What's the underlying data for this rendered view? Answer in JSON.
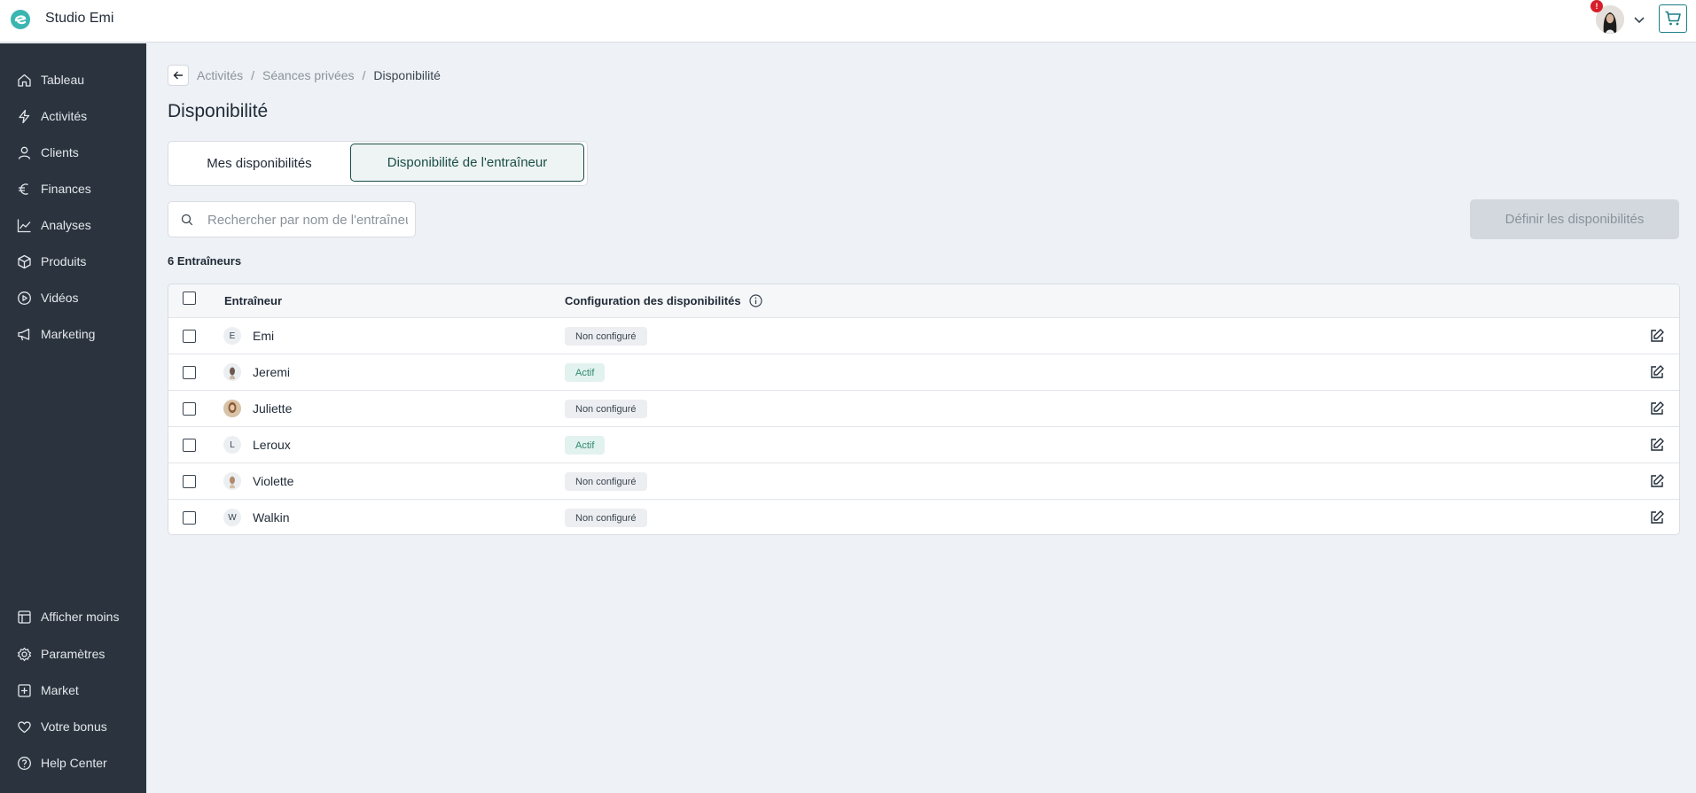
{
  "header": {
    "studio_name": "Studio Emi",
    "notification_count": "!",
    "avatar_icon": "user-avatar",
    "cart_icon": "cart-icon",
    "brand_color": "#1b7f88"
  },
  "sidebar": {
    "items": [
      {
        "label": "Tableau",
        "icon": "home-icon"
      },
      {
        "label": "Activités",
        "icon": "bolt-icon"
      },
      {
        "label": "Clients",
        "icon": "user-icon"
      },
      {
        "label": "Finances",
        "icon": "euro-icon"
      },
      {
        "label": "Analyses",
        "icon": "chart-line-icon"
      },
      {
        "label": "Produits",
        "icon": "box-icon"
      },
      {
        "label": "Vidéos",
        "icon": "play-circle-icon"
      },
      {
        "label": "Marketing",
        "icon": "megaphone-icon"
      }
    ],
    "bottom_items": [
      {
        "label": "Afficher moins",
        "icon": "panel-icon"
      },
      {
        "label": "Paramètres",
        "icon": "gear-icon"
      },
      {
        "label": "Market",
        "icon": "plus-square-icon"
      },
      {
        "label": "Votre bonus",
        "icon": "heart-icon"
      },
      {
        "label": "Help Center",
        "icon": "help-circle-icon"
      }
    ]
  },
  "breadcrumb": {
    "items": [
      "Activités",
      "Séances privées"
    ],
    "current": "Disponibilité",
    "separator": "/"
  },
  "page": {
    "title": "Disponibilité",
    "tabs": [
      {
        "label": "Mes disponibilités",
        "active": false
      },
      {
        "label": "Disponibilité de l'entraîneur",
        "active": true
      }
    ],
    "search_placeholder": "Rechercher par nom de l'entraîneur",
    "define_button": "Définir les disponibilités",
    "count_label": "6 Entraîneurs"
  },
  "table": {
    "columns": [
      "Entraîneur",
      "Configuration des disponibilités"
    ],
    "rows": [
      {
        "initial": "E",
        "name": "Emi",
        "status": "Non configuré",
        "active": false,
        "photo": false
      },
      {
        "initial": "",
        "name": "Jeremi",
        "status": "Actif",
        "active": true,
        "photo": true
      },
      {
        "initial": "",
        "name": "Juliette",
        "status": "Non configuré",
        "active": false,
        "photo": true
      },
      {
        "initial": "L",
        "name": "Leroux",
        "status": "Actif",
        "active": true,
        "photo": false
      },
      {
        "initial": "",
        "name": "Violette",
        "status": "Non configuré",
        "active": false,
        "photo": true
      },
      {
        "initial": "W",
        "name": "Walkin",
        "status": "Non configuré",
        "active": false,
        "photo": false
      }
    ]
  }
}
